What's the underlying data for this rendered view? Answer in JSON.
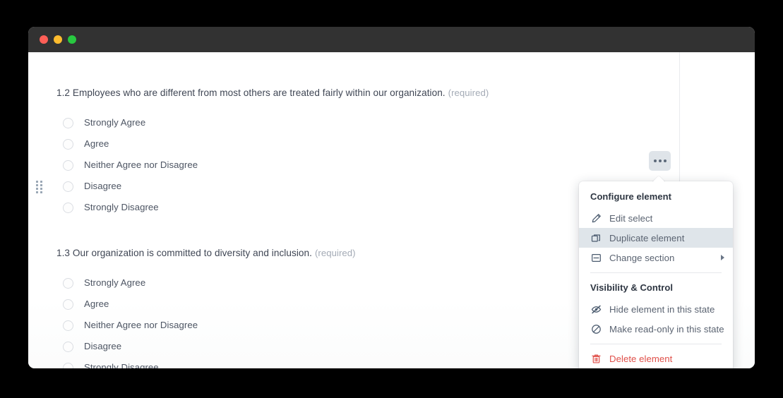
{
  "window": {
    "traffic_lights": [
      {
        "name": "close",
        "color": "#ff5f57"
      },
      {
        "name": "minimize",
        "color": "#febc2e"
      },
      {
        "name": "maximize",
        "color": "#28c840"
      }
    ]
  },
  "form": {
    "questions": [
      {
        "number": "1.2",
        "text": "1.2 Employees who are different from most others are treated fairly within our organization.",
        "required_label": "(required)",
        "options": [
          "Strongly Agree",
          "Agree",
          "Neither Agree nor Disagree",
          "Disagree",
          "Strongly Disagree"
        ]
      },
      {
        "number": "1.3",
        "text": "1.3 Our organization is committed to diversity and inclusion.",
        "required_label": "(required)",
        "options": [
          "Strongly Agree",
          "Agree",
          "Neither Agree nor Disagree",
          "Disagree",
          "Strongly Disagree"
        ]
      }
    ]
  },
  "toolbar": {
    "kebab_icon": "ellipsis-icon"
  },
  "context_menu": {
    "sections": [
      {
        "heading": "Configure element",
        "items": [
          {
            "label": "Edit select",
            "icon": "pencil-icon",
            "highlighted": false,
            "has_submenu": false
          },
          {
            "label": "Duplicate element",
            "icon": "duplicate-icon",
            "highlighted": true,
            "has_submenu": false
          },
          {
            "label": "Change section",
            "icon": "section-icon",
            "highlighted": false,
            "has_submenu": true
          }
        ]
      },
      {
        "heading": "Visibility & Control",
        "items": [
          {
            "label": "Hide element in this state",
            "icon": "eye-off-icon",
            "highlighted": false,
            "has_submenu": false
          },
          {
            "label": "Make read-only in this state",
            "icon": "no-entry-icon",
            "highlighted": false,
            "has_submenu": false
          }
        ]
      },
      {
        "heading": null,
        "items": [
          {
            "label": "Delete element",
            "icon": "trash-icon",
            "highlighted": false,
            "has_submenu": false,
            "danger": true
          }
        ]
      }
    ],
    "colors": {
      "highlight": "#dfe5ea",
      "danger": "#e0514b",
      "heading": "#2e3642",
      "label": "#5a6371"
    }
  }
}
